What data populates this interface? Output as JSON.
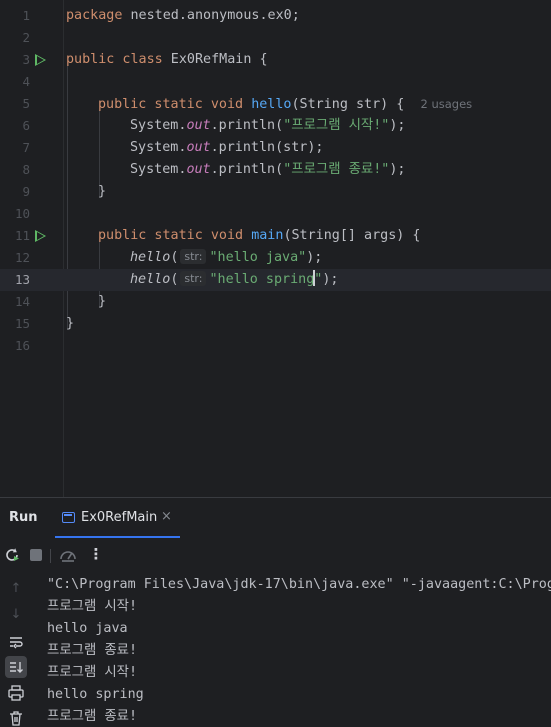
{
  "editor": {
    "line_numbers": [
      "1",
      "2",
      "3",
      "4",
      "5",
      "6",
      "7",
      "8",
      "9",
      "10",
      "11",
      "12",
      "13",
      "14",
      "15",
      "16"
    ],
    "current_line": 13,
    "line1": {
      "kw": "package",
      "rest": " nested.anonymous.ex0;"
    },
    "line3": {
      "kw": "public class",
      "rest": " Ex0RefMain {"
    },
    "line5": {
      "kw": "public static void",
      "fn": "hello",
      "rest": "(String str) {",
      "hint": "2 usages"
    },
    "line6": {
      "pre": "System.",
      "field": "out",
      "mid": ".println(",
      "str": "\"프로그램 시작!\"",
      "end": ");"
    },
    "line7": {
      "pre": "System.",
      "field": "out",
      "mid": ".println(str);"
    },
    "line8": {
      "pre": "System.",
      "field": "out",
      "mid": ".println(",
      "str": "\"프로그램 종료!\"",
      "end": ");"
    },
    "line9": {
      "text": "}"
    },
    "line11": {
      "kw": "public static void",
      "fn": "main",
      "rest": "(String[] args) {"
    },
    "line12": {
      "call": "hello",
      "open": "(",
      "param_hint": "str:",
      "str": "\"hello java\"",
      "end": ");"
    },
    "line13": {
      "call": "hello",
      "open": "(",
      "param_hint": "str:",
      "str_before_caret": "\"hello spring",
      "str_after_caret": "\"",
      "end": ");"
    },
    "line14": {
      "text": "}"
    },
    "line15": {
      "text": "}"
    }
  },
  "run_panel": {
    "title": "Run",
    "tab_label": "Ex0RefMain",
    "tab_close": "×",
    "more": "⋮",
    "rail": {
      "up": "↑",
      "down": "↓"
    },
    "console_lines": [
      "\"C:\\Program Files\\Java\\jdk-17\\bin\\java.exe\" \"-javaagent:C:\\Prog",
      "프로그램 시작!",
      "hello java",
      "프로그램 종료!",
      "프로그램 시작!",
      "hello spring",
      "프로그램 종료!"
    ]
  },
  "colors": {
    "background": "#1e1f22",
    "keyword": "#cf8e6d",
    "function": "#56a8f5",
    "string": "#6aab73",
    "static_field": "#c77dbb",
    "run_gutter": "#5fb865",
    "accent": "#3574f0"
  },
  "icons": {
    "gutter": "run-triangle-icon",
    "toolbar": [
      "rerun-icon",
      "stop-icon",
      "thread-dump-icon",
      "more-options-icon"
    ],
    "rail": [
      "up-arrow-icon",
      "down-arrow-icon",
      "soft-wrap-icon",
      "scroll-to-end-icon",
      "print-icon",
      "trash-icon"
    ]
  }
}
